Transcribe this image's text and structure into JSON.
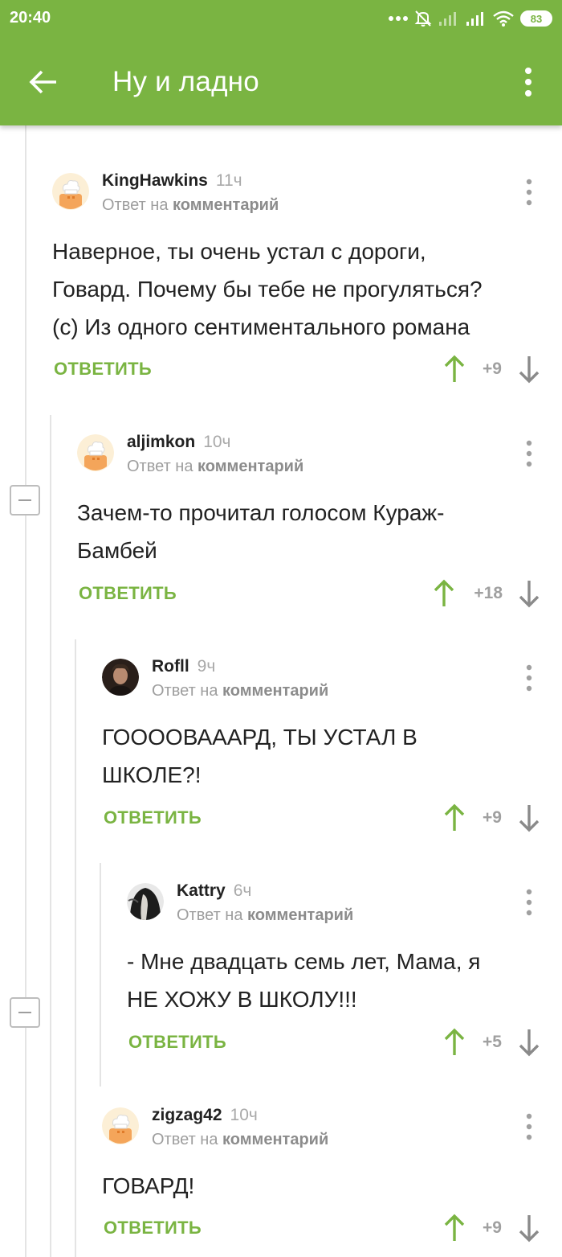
{
  "status_bar": {
    "time": "20:40",
    "battery": "83",
    "icons": [
      "dots-icon",
      "mute-icon",
      "signal-icon",
      "signal-icon",
      "wifi-icon",
      "battery-icon"
    ]
  },
  "toolbar": {
    "title": "Ну и ладно",
    "back_icon": "arrow-left-icon",
    "menu_icon": "more-vertical-icon"
  },
  "colors": {
    "accent": "#7ab442",
    "upvote": "#7ab442",
    "downvote": "#8a8a8a",
    "thread_line": "#e4e4e4"
  },
  "comments": [
    {
      "user": "KingHawkins",
      "time": "11ч",
      "reply_prefix": "Ответ на",
      "reply_target": "комментарий",
      "text_lines": [
        "Наверное, ты очень устал с дороги,",
        "Говард. Почему бы тебе не прогуляться?",
        "(с) Из одного сентиментального романа"
      ],
      "reply_label": "ОТВЕТИТЬ",
      "score": "+9"
    },
    {
      "user": "aljimkon",
      "time": "10ч",
      "reply_prefix": "Ответ на",
      "reply_target": "комментарий",
      "text_lines": [
        "Зачем-то прочитал голосом Кураж-",
        "Бамбей"
      ],
      "reply_label": "ОТВЕТИТЬ",
      "score": "+18"
    },
    {
      "user": "Rofll",
      "time": "9ч",
      "reply_prefix": "Ответ на",
      "reply_target": "комментарий",
      "text_lines": [
        "ГООООВАААРД, ТЫ УСТАЛ В",
        "ШКОЛЕ?!"
      ],
      "reply_label": "ОТВЕТИТЬ",
      "score": "+9"
    },
    {
      "user": "Kattry",
      "time": "6ч",
      "reply_prefix": "Ответ на",
      "reply_target": "комментарий",
      "text_lines": [
        "- Мне двадцать семь лет, Мама, я",
        "НЕ ХОЖУ В ШКОЛУ!!!"
      ],
      "reply_label": "ОТВЕТИТЬ",
      "score": "+5"
    },
    {
      "user": "zigzag42",
      "time": "10ч",
      "reply_prefix": "Ответ на",
      "reply_target": "комментарий",
      "text_lines": [
        "ГОВАРД!"
      ],
      "reply_label": "ОТВЕТИТЬ",
      "score": "+9"
    }
  ]
}
